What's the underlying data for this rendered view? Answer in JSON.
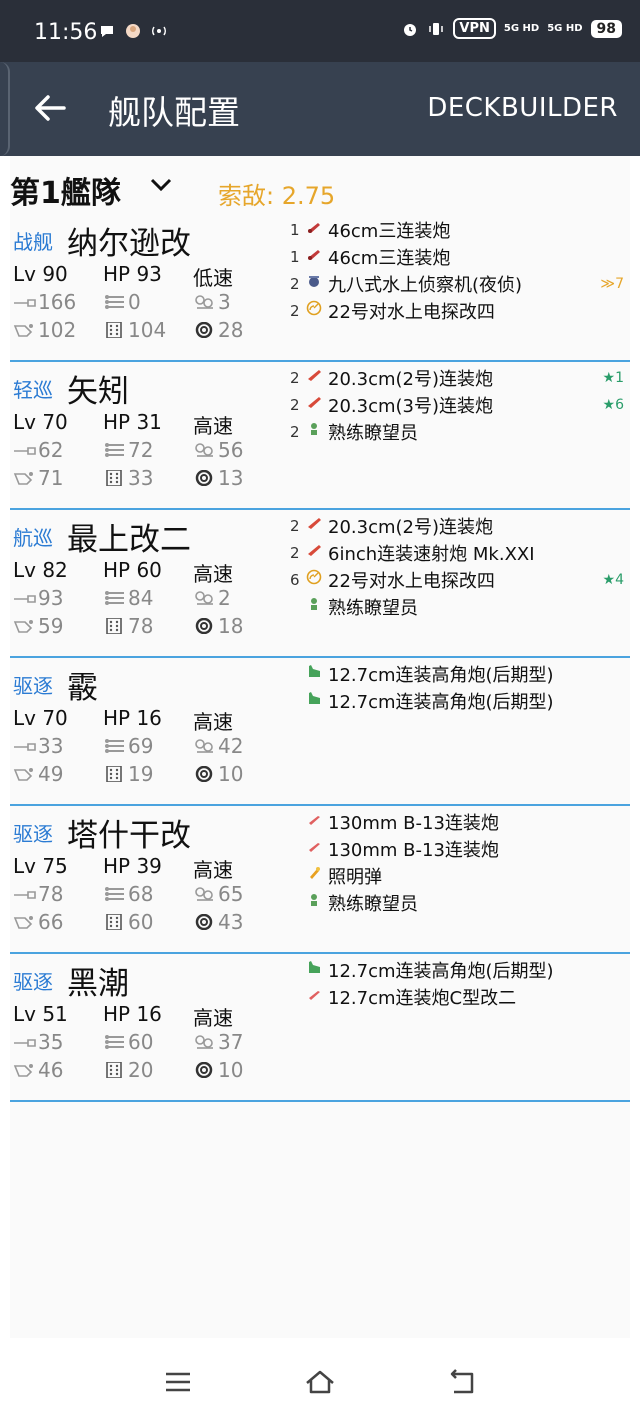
{
  "status_bar": {
    "time": "11:56",
    "vpn": "VPN",
    "net1": "5G HD",
    "net2": "5G HD",
    "battery": "98"
  },
  "app_bar": {
    "title": "舰队配置",
    "action": "DECKBUILDER"
  },
  "fleet": {
    "name": "第1艦隊",
    "los_label": "索敌: 2.75"
  },
  "ships": [
    {
      "type": "战舰",
      "name": "纳尔逊改",
      "lv": "Lv 90",
      "hp": "HP 93",
      "speed": "低速",
      "fp": "166",
      "torp": "0",
      "aa": "3",
      "asw": "102",
      "los": "104",
      "luck": "28",
      "equipment": [
        {
          "slot": "1",
          "icon": "main-gun-large",
          "name": "46cm三连装炮",
          "badge": ""
        },
        {
          "slot": "1",
          "icon": "main-gun-large",
          "name": "46cm三连装炮",
          "badge": ""
        },
        {
          "slot": "2",
          "icon": "seaplane-recon",
          "name": "九八式水上侦察机(夜侦)",
          "badge": "≫7"
        },
        {
          "slot": "2",
          "icon": "radar",
          "name": "22号对水上电探改四",
          "badge": ""
        }
      ]
    },
    {
      "type": "轻巡",
      "name": "矢矧",
      "lv": "Lv 70",
      "hp": "HP 31",
      "speed": "高速",
      "fp": "62",
      "torp": "72",
      "aa": "56",
      "asw": "71",
      "los": "33",
      "luck": "13",
      "equipment": [
        {
          "slot": "2",
          "icon": "main-gun-medium",
          "name": "20.3cm(2号)连装炮",
          "badge": "★1"
        },
        {
          "slot": "2",
          "icon": "main-gun-medium",
          "name": "20.3cm(3号)连装炮",
          "badge": "★6"
        },
        {
          "slot": "2",
          "icon": "lookout",
          "name": "熟练瞭望员",
          "badge": ""
        }
      ]
    },
    {
      "type": "航巡",
      "name": "最上改二",
      "lv": "Lv 82",
      "hp": "HP 60",
      "speed": "高速",
      "fp": "93",
      "torp": "84",
      "aa": "2",
      "asw": "59",
      "los": "78",
      "luck": "18",
      "equipment": [
        {
          "slot": "2",
          "icon": "main-gun-medium",
          "name": "20.3cm(2号)连装炮",
          "badge": ""
        },
        {
          "slot": "2",
          "icon": "main-gun-medium",
          "name": "6inch连装速射炮 Mk.XXI",
          "badge": ""
        },
        {
          "slot": "6",
          "icon": "radar",
          "name": "22号对水上电探改四",
          "badge": "★4"
        },
        {
          "slot": "",
          "icon": "lookout",
          "name": "熟练瞭望员",
          "badge": ""
        }
      ]
    },
    {
      "type": "驱逐",
      "name": "霰",
      "lv": "Lv 70",
      "hp": "HP 16",
      "speed": "高速",
      "fp": "33",
      "torp": "69",
      "aa": "42",
      "asw": "49",
      "los": "19",
      "luck": "10",
      "equipment": [
        {
          "slot": "",
          "icon": "small-gun-green",
          "name": "12.7cm连装高角炮(后期型)",
          "badge": ""
        },
        {
          "slot": "",
          "icon": "small-gun-green",
          "name": "12.7cm连装高角炮(后期型)",
          "badge": ""
        }
      ]
    },
    {
      "type": "驱逐",
      "name": "塔什干改",
      "lv": "Lv 75",
      "hp": "HP 39",
      "speed": "高速",
      "fp": "78",
      "torp": "68",
      "aa": "65",
      "asw": "66",
      "los": "60",
      "luck": "43",
      "equipment": [
        {
          "slot": "",
          "icon": "small-gun-red",
          "name": "130mm B-13连装炮",
          "badge": ""
        },
        {
          "slot": "",
          "icon": "small-gun-red",
          "name": "130mm B-13连装炮",
          "badge": ""
        },
        {
          "slot": "",
          "icon": "flare",
          "name": "照明弹",
          "badge": ""
        },
        {
          "slot": "",
          "icon": "lookout",
          "name": "熟练瞭望员",
          "badge": ""
        }
      ]
    },
    {
      "type": "驱逐",
      "name": "黑潮",
      "lv": "Lv 51",
      "hp": "HP 16",
      "speed": "高速",
      "fp": "35",
      "torp": "60",
      "aa": "37",
      "asw": "46",
      "los": "20",
      "luck": "10",
      "equipment": [
        {
          "slot": "",
          "icon": "small-gun-green",
          "name": "12.7cm连装高角炮(后期型)",
          "badge": ""
        },
        {
          "slot": "",
          "icon": "small-gun-red",
          "name": "12.7cm连装炮C型改二",
          "badge": ""
        }
      ]
    }
  ],
  "colors": {
    "status_bar_bg": "#2a2f39",
    "app_bar_bg": "#374150",
    "ship_type": "#2b7bd3",
    "los_accent": "#e6a62b",
    "divider": "#4aa3df",
    "star": "#2a9d6a"
  }
}
